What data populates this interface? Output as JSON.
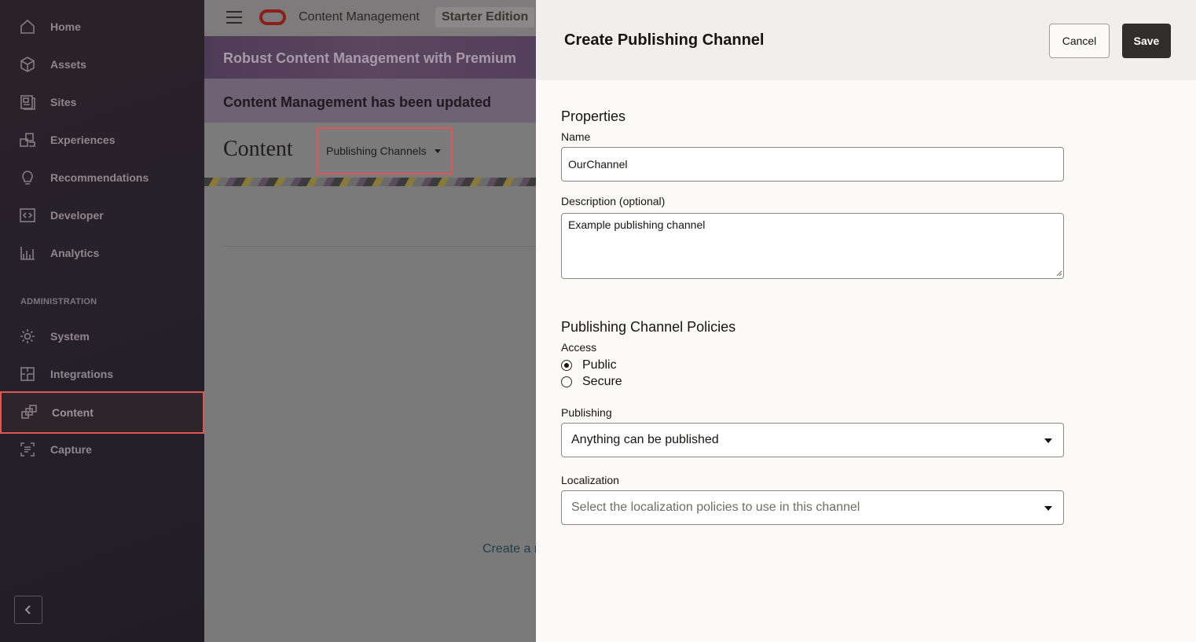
{
  "sidebar": {
    "items": [
      {
        "label": "Home",
        "icon": "home-icon"
      },
      {
        "label": "Assets",
        "icon": "cube-icon"
      },
      {
        "label": "Sites",
        "icon": "sites-icon"
      },
      {
        "label": "Experiences",
        "icon": "experiences-icon"
      },
      {
        "label": "Recommendations",
        "icon": "lightbulb-icon"
      },
      {
        "label": "Developer",
        "icon": "code-icon"
      },
      {
        "label": "Analytics",
        "icon": "chart-icon"
      }
    ],
    "admin_section": "ADMINISTRATION",
    "admin_items": [
      {
        "label": "System",
        "icon": "gear-icon"
      },
      {
        "label": "Integrations",
        "icon": "puzzle-icon"
      },
      {
        "label": "Content",
        "icon": "content-icon"
      },
      {
        "label": "Capture",
        "icon": "capture-icon"
      }
    ],
    "colors": {
      "highlight": "#e05654"
    }
  },
  "topbar": {
    "app_title": "Content Management",
    "edition": "Starter Edition"
  },
  "banners": {
    "premium": "Robust Content Management with Premium",
    "updated": "Content Management has been updated"
  },
  "content_page": {
    "title": "Content",
    "dropdown_label": "Publishing Channels",
    "create_link": "Create a r"
  },
  "drawer": {
    "title": "Create Publishing Channel",
    "cancel_label": "Cancel",
    "save_label": "Save",
    "properties": {
      "section_title": "Properties",
      "name_label": "Name",
      "name_value": "OurChannel",
      "description_label": "Description (optional)",
      "description_value": "Example publishing channel"
    },
    "policies": {
      "section_title": "Publishing Channel Policies",
      "access_label": "Access",
      "access_options": [
        {
          "label": "Public",
          "selected": true
        },
        {
          "label": "Secure",
          "selected": false
        }
      ],
      "publishing_label": "Publishing",
      "publishing_value": "Anything can be published",
      "localization_label": "Localization",
      "localization_placeholder": "Select the localization policies to use in this channel"
    },
    "colors": {
      "save_bg": "#312d2a"
    }
  }
}
